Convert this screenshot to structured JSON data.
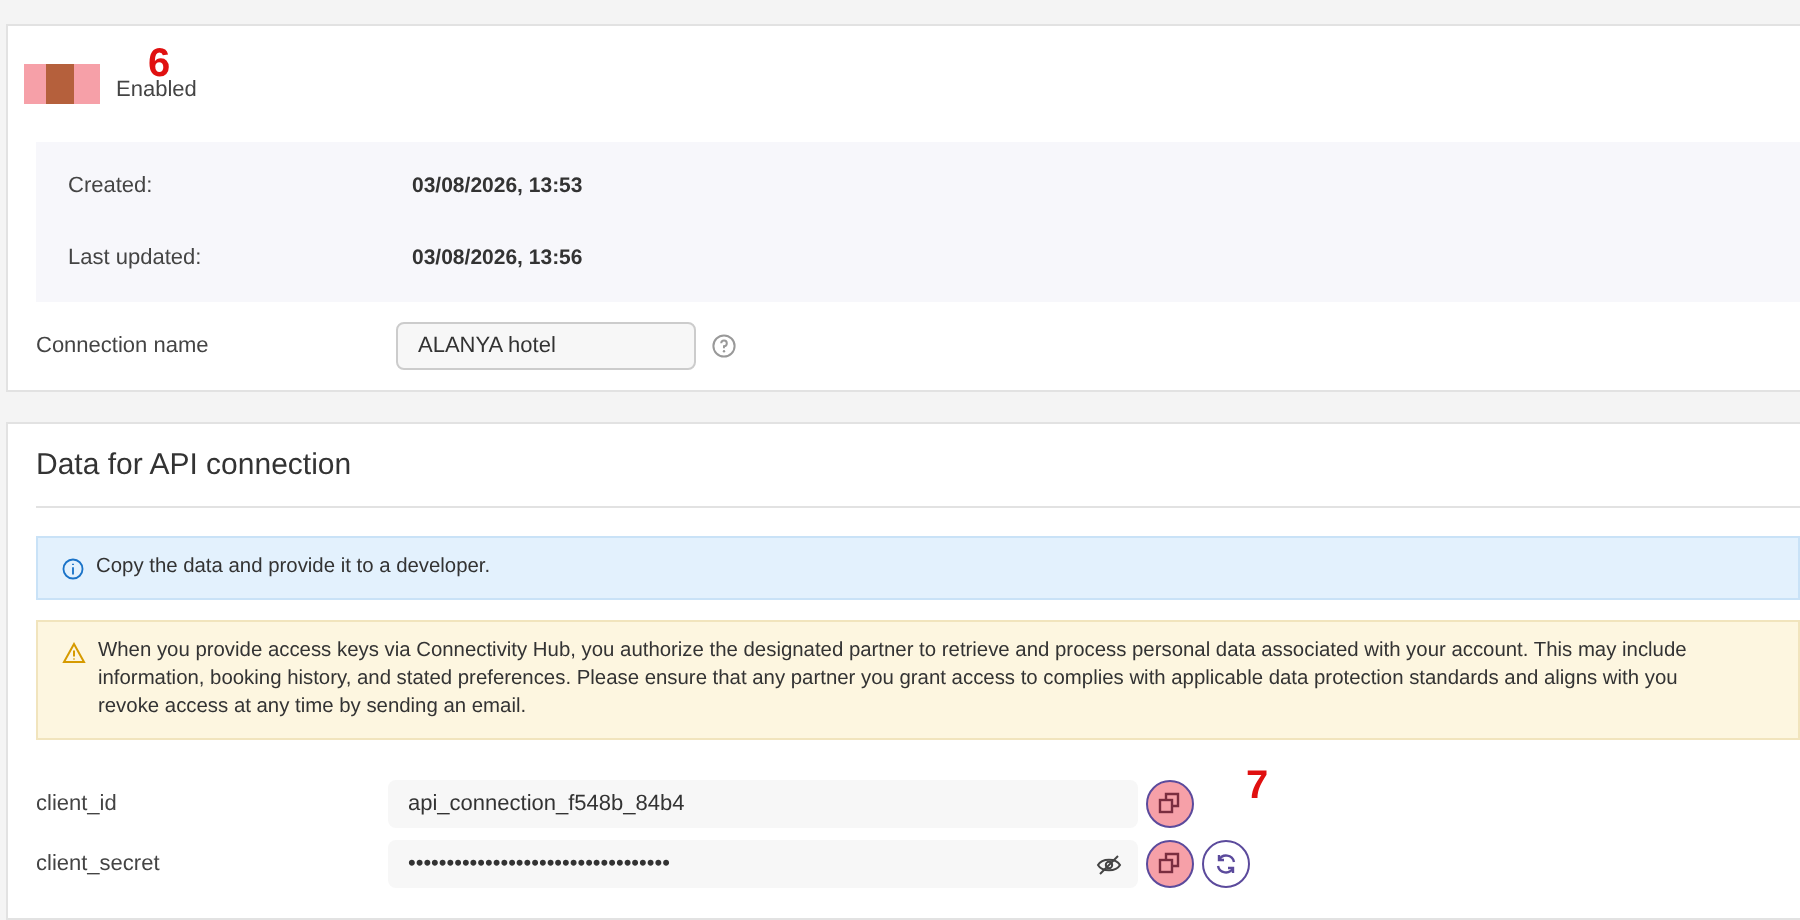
{
  "status": {
    "label": "Enabled",
    "on": true,
    "annotation": "6"
  },
  "meta": [
    {
      "label": "Created:",
      "value": "03/08/2026, 13:53"
    },
    {
      "label": "Last updated:",
      "value": "03/08/2026, 13:56"
    }
  ],
  "connection_name": {
    "label": "Connection name",
    "value": "ALANYA hotel"
  },
  "api_section": {
    "title": "Data for API connection",
    "info": "Copy the data and provide it to a developer.",
    "warning": "When you provide access keys via Connectivity Hub, you authorize the designated partner to retrieve and process personal data associated with your account. This may include\ninformation, booking history, and stated preferences. Please ensure that any partner you grant access to complies with applicable data protection standards and aligns with you\nrevoke access at any time by sending an email.",
    "fields": [
      {
        "label": "client_id",
        "value": "api_connection_f548b_84b4",
        "kind": "plain",
        "annotation": "7"
      },
      {
        "label": "client_secret",
        "value": "••••••••••••••••••••••••••••••••••",
        "kind": "secret"
      }
    ]
  }
}
